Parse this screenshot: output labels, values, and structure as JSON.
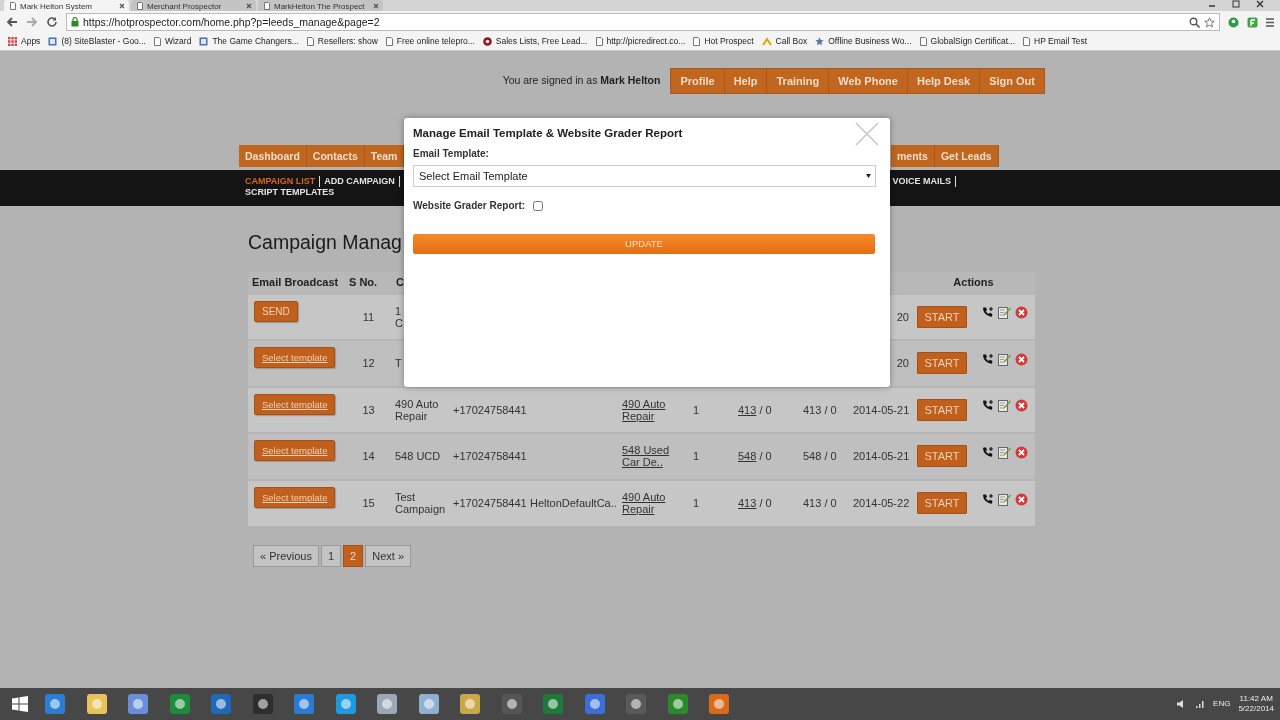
{
  "browser": {
    "tabs": [
      {
        "title": "Mark Helton System",
        "selected": true
      },
      {
        "title": "Merchant Prospector",
        "selected": false
      },
      {
        "title": "MarkHelton The Prospect",
        "selected": false
      }
    ],
    "url": "https://hotprospector.com/home.php?p=leeds_manage&page=2",
    "bookmarks": [
      {
        "label": "Apps",
        "kind": "grid"
      },
      {
        "label": "(8) SiteBlaster - Goo...",
        "kind": "square"
      },
      {
        "label": "Wizard",
        "kind": "page"
      },
      {
        "label": "The Game Changers...",
        "kind": "square"
      },
      {
        "label": "Resellers: show",
        "kind": "page"
      },
      {
        "label": "Free online telepro...",
        "kind": "page"
      },
      {
        "label": "Sales Lists, Free Lead...",
        "kind": "circle"
      },
      {
        "label": "http://picredirect.co...",
        "kind": "page"
      },
      {
        "label": "Hot Prospect",
        "kind": "page"
      },
      {
        "label": "Call Box",
        "kind": "chevron"
      },
      {
        "label": "Offline Business Wo...",
        "kind": "star"
      },
      {
        "label": "GlobalSign Certificat...",
        "kind": "page"
      },
      {
        "label": "HP Email Test",
        "kind": "page"
      }
    ]
  },
  "header": {
    "signed_in": "You are signed in as",
    "user": "Mark Helton",
    "links": [
      "Profile",
      "Help",
      "Training",
      "Web Phone",
      "Help Desk",
      "Sign Out"
    ]
  },
  "main_nav": {
    "left": [
      "Dashboard",
      "Contacts",
      "Team"
    ],
    "right": [
      "ments",
      "Get Leads"
    ]
  },
  "sub_nav": {
    "left": [
      {
        "label": "CAMPAIGN LIST",
        "selected": true
      },
      {
        "label": "ADD CAMPAIGN",
        "selected": false
      }
    ],
    "right": [
      {
        "label": "VOICE MAILS",
        "selected": false
      }
    ],
    "second_line": [
      {
        "label": "SCRIPT TEMPLATES",
        "selected": false
      }
    ]
  },
  "heading": "Campaign Manag",
  "table": {
    "headers": {
      "email_broadcast": "Email Broadcast",
      "s_no": "S No.",
      "column_3": "C",
      "actions": "Actions"
    },
    "rows": [
      {
        "broadcast": {
          "kind": "send",
          "label": "SEND"
        },
        "s_no": "11",
        "campaign": "1\nC",
        "date": "20",
        "start": "START"
      },
      {
        "broadcast": {
          "kind": "select",
          "label": "Select template"
        },
        "s_no": "12",
        "campaign": "T",
        "date": "20",
        "start": "START"
      },
      {
        "broadcast": {
          "kind": "select",
          "label": "Select template"
        },
        "s_no": "13",
        "campaign": "490 Auto Repair",
        "phone": "+17024758441",
        "list": "490 Auto Repair",
        "count": "1",
        "sent_link": "413",
        "sent_rest": "/ 0",
        "delivered": "413 / 0",
        "date": "2014-05-21",
        "start": "START"
      },
      {
        "broadcast": {
          "kind": "select",
          "label": "Select template"
        },
        "s_no": "14",
        "campaign": "548 UCD",
        "phone": "+17024758441",
        "list": "548 Used Car De..",
        "count": "1",
        "sent_link": "548",
        "sent_rest": "/ 0",
        "delivered": "548 / 0",
        "date": "2014-05-21",
        "start": "START"
      },
      {
        "broadcast": {
          "kind": "select",
          "label": "Select template"
        },
        "s_no": "15",
        "campaign": "Test Campaign",
        "phone": "+17024758441",
        "script": "HeltonDefaultCa..",
        "list": "490 Auto Repair",
        "count": "1",
        "sent_link": "413",
        "sent_rest": "/ 0",
        "delivered": "413 / 0",
        "date": "2014-05-22",
        "start": "START"
      }
    ]
  },
  "pagination": [
    {
      "label": "« Previous",
      "selected": false
    },
    {
      "label": "1",
      "selected": false
    },
    {
      "label": "2",
      "selected": true
    },
    {
      "label": "Next »",
      "selected": false
    }
  ],
  "modal": {
    "title": "Manage Email Template & Website Grader Report",
    "template_label": "Email Template:",
    "template_value": "Select Email Template",
    "grader_label": "Website Grader Report:",
    "grader_checked": false,
    "button": "UPDATE"
  },
  "taskbar": {
    "language": "ENG",
    "time": "11:42 AM",
    "date": "5/22/2014"
  }
}
